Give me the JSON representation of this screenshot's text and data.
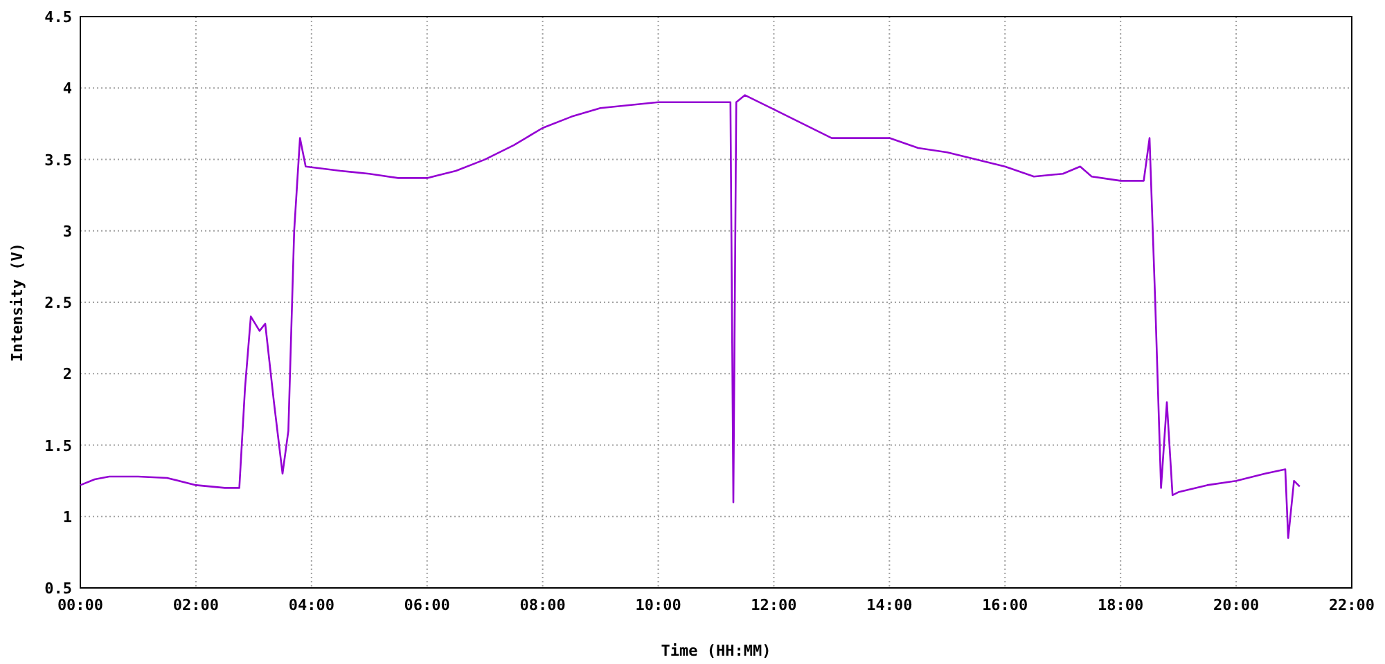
{
  "chart": {
    "chart_data": {
      "type": "line",
      "xlabel": "Time (HH:MM)",
      "ylabel": "Intensity (V)",
      "x": [
        0,
        0.25,
        0.5,
        1,
        1.5,
        2,
        2.5,
        2.75,
        2.85,
        2.95,
        3.1,
        3.2,
        3.35,
        3.5,
        3.6,
        3.7,
        3.8,
        3.9,
        4.5,
        5,
        5.5,
        6,
        6.5,
        7,
        7.5,
        8,
        8.5,
        9,
        9.5,
        10,
        10.5,
        11,
        11.25,
        11.3,
        11.35,
        11.5,
        12,
        12.5,
        13,
        13.5,
        14,
        14.5,
        15,
        15.5,
        16,
        16.5,
        17,
        17.3,
        17.5,
        18,
        18.4,
        18.5,
        18.6,
        18.7,
        18.8,
        18.9,
        19,
        19.5,
        20,
        20.5,
        20.85,
        20.9,
        21,
        21.1
      ],
      "series": [
        {
          "color": "#9400d3",
          "values": [
            1.22,
            1.26,
            1.28,
            1.28,
            1.27,
            1.22,
            1.2,
            1.2,
            1.9,
            2.4,
            2.3,
            2.35,
            1.8,
            1.3,
            1.6,
            3.0,
            3.65,
            3.45,
            3.42,
            3.4,
            3.37,
            3.37,
            3.42,
            3.5,
            3.6,
            3.72,
            3.8,
            3.86,
            3.88,
            3.9,
            3.9,
            3.9,
            3.9,
            1.1,
            3.9,
            3.95,
            3.85,
            3.75,
            3.65,
            3.65,
            3.65,
            3.58,
            3.55,
            3.5,
            3.45,
            3.38,
            3.4,
            3.45,
            3.38,
            3.35,
            3.35,
            3.65,
            2.5,
            1.2,
            1.8,
            1.15,
            1.17,
            1.22,
            1.25,
            1.3,
            1.33,
            0.85,
            1.25,
            1.21
          ]
        }
      ],
      "xlim": [
        0,
        22
      ],
      "ylim": [
        0.5,
        4.5
      ],
      "xticks": [
        {
          "value": 0,
          "label": "00:00"
        },
        {
          "value": 2,
          "label": "02:00"
        },
        {
          "value": 4,
          "label": "04:00"
        },
        {
          "value": 6,
          "label": "06:00"
        },
        {
          "value": 8,
          "label": "08:00"
        },
        {
          "value": 10,
          "label": "10:00"
        },
        {
          "value": 12,
          "label": "12:00"
        },
        {
          "value": 14,
          "label": "14:00"
        },
        {
          "value": 16,
          "label": "16:00"
        },
        {
          "value": 18,
          "label": "18:00"
        },
        {
          "value": 20,
          "label": "20:00"
        },
        {
          "value": 22,
          "label": "22:00"
        }
      ],
      "yticks": [
        0.5,
        1,
        1.5,
        2,
        2.5,
        3,
        3.5,
        4,
        4.5
      ],
      "grid": true
    }
  }
}
